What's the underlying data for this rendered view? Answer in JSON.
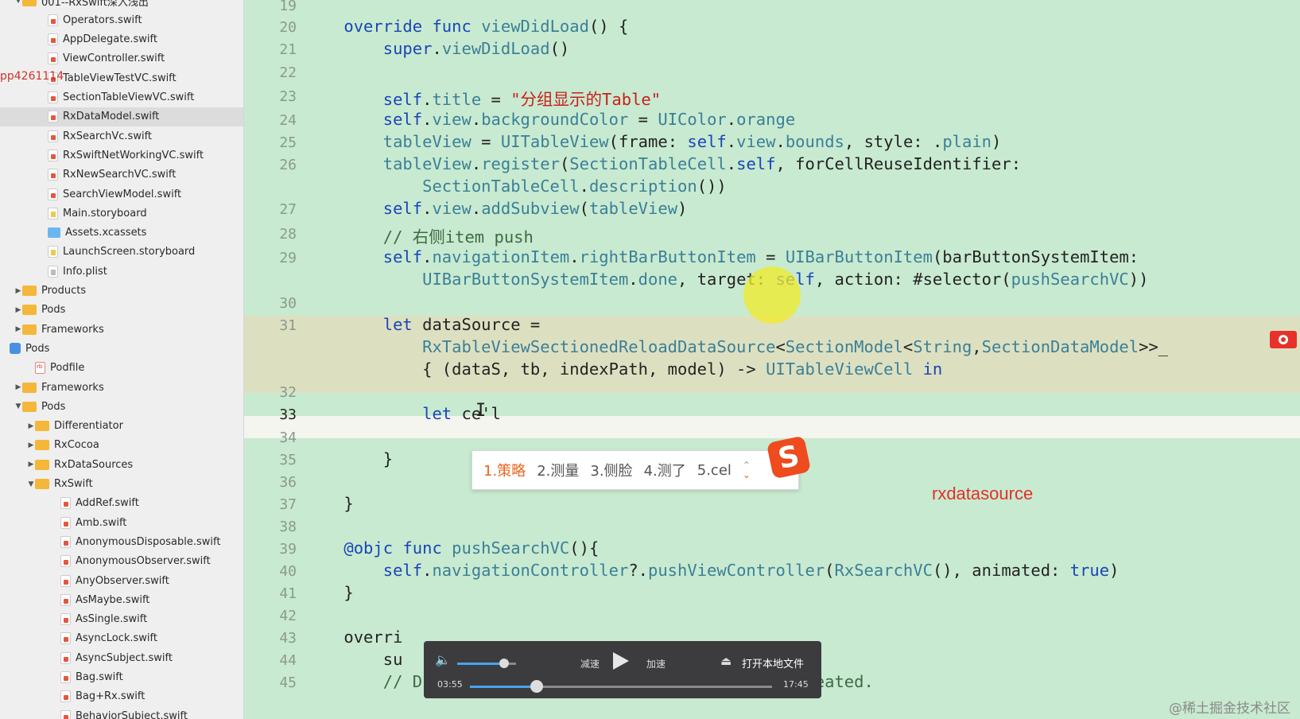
{
  "sidebar": {
    "items": [
      {
        "label": "001--RxSwift深入浅出",
        "icon": "folder-icon",
        "indent": 1,
        "expanded": true
      },
      {
        "label": "Operators.swift",
        "icon": "swift-file-icon",
        "indent": 3
      },
      {
        "label": "AppDelegate.swift",
        "icon": "swift-file-icon",
        "indent": 3
      },
      {
        "label": "ViewController.swift",
        "icon": "swift-file-icon",
        "indent": 3
      },
      {
        "label": "TableViewTestVC.swift",
        "icon": "swift-file-icon",
        "indent": 3
      },
      {
        "label": "SectionTableViewVC.swift",
        "icon": "swift-file-icon",
        "indent": 3
      },
      {
        "label": "RxDataModel.swift",
        "icon": "swift-file-icon",
        "indent": 3,
        "selected": true
      },
      {
        "label": "RxSearchVc.swift",
        "icon": "swift-file-icon",
        "indent": 3
      },
      {
        "label": "RxSwiftNetWorkingVC.swift",
        "icon": "swift-file-icon",
        "indent": 3
      },
      {
        "label": "RxNewSearchVC.swift",
        "icon": "swift-file-icon",
        "indent": 3
      },
      {
        "label": "SearchViewModel.swift",
        "icon": "swift-file-icon",
        "indent": 3
      },
      {
        "label": "Main.storyboard",
        "icon": "storyboard-file-icon",
        "indent": 3
      },
      {
        "label": "Assets.xcassets",
        "icon": "assets-folder-icon",
        "indent": 3
      },
      {
        "label": "LaunchScreen.storyboard",
        "icon": "storyboard-file-icon",
        "indent": 3
      },
      {
        "label": "Info.plist",
        "icon": "plist-file-icon",
        "indent": 3
      },
      {
        "label": "Products",
        "icon": "folder-icon",
        "indent": 1,
        "collapsed": true
      },
      {
        "label": "Pods",
        "icon": "folder-icon",
        "indent": 1,
        "collapsed": true
      },
      {
        "label": "Frameworks",
        "icon": "folder-icon",
        "indent": 1,
        "collapsed": true
      },
      {
        "label": "Pods",
        "icon": "pods-project-icon",
        "indent": 0
      },
      {
        "label": "Podfile",
        "icon": "podfile-icon",
        "indent": 2
      },
      {
        "label": "Frameworks",
        "icon": "folder-icon",
        "indent": 1,
        "collapsed": true
      },
      {
        "label": "Pods",
        "icon": "folder-icon",
        "indent": 1,
        "expanded": true
      },
      {
        "label": "Differentiator",
        "icon": "folder-icon",
        "indent": 2,
        "collapsed": true
      },
      {
        "label": "RxCocoa",
        "icon": "folder-icon",
        "indent": 2,
        "collapsed": true
      },
      {
        "label": "RxDataSources",
        "icon": "folder-icon",
        "indent": 2,
        "collapsed": true
      },
      {
        "label": "RxSwift",
        "icon": "folder-icon",
        "indent": 2,
        "expanded": true
      },
      {
        "label": "AddRef.swift",
        "icon": "swift-file-icon",
        "indent": 4
      },
      {
        "label": "Amb.swift",
        "icon": "swift-file-icon",
        "indent": 4
      },
      {
        "label": "AnonymousDisposable.swift",
        "icon": "swift-file-icon",
        "indent": 4
      },
      {
        "label": "AnonymousObserver.swift",
        "icon": "swift-file-icon",
        "indent": 4
      },
      {
        "label": "AnyObserver.swift",
        "icon": "swift-file-icon",
        "indent": 4
      },
      {
        "label": "AsMaybe.swift",
        "icon": "swift-file-icon",
        "indent": 4
      },
      {
        "label": "AsSingle.swift",
        "icon": "swift-file-icon",
        "indent": 4
      },
      {
        "label": "AsyncLock.swift",
        "icon": "swift-file-icon",
        "indent": 4
      },
      {
        "label": "AsyncSubject.swift",
        "icon": "swift-file-icon",
        "indent": 4
      },
      {
        "label": "Bag.swift",
        "icon": "swift-file-icon",
        "indent": 4
      },
      {
        "label": "Bag+Rx.swift",
        "icon": "swift-file-icon",
        "indent": 4
      },
      {
        "label": "BehaviorSubject.swift",
        "icon": "swift-file-icon",
        "indent": 4
      }
    ],
    "overlay_label": "pp4261114"
  },
  "editor": {
    "lines": [
      {
        "num": "19",
        "code": ""
      },
      {
        "num": "20",
        "code": "    override func viewDidLoad() {"
      },
      {
        "num": "21",
        "code": "        super.viewDidLoad()"
      },
      {
        "num": "22",
        "code": ""
      },
      {
        "num": "23",
        "code": "        self.title = \"分组显示的Table\""
      },
      {
        "num": "24",
        "code": "        self.view.backgroundColor = UIColor.orange"
      },
      {
        "num": "25",
        "code": "        tableView = UITableView(frame: self.view.bounds, style: .plain)"
      },
      {
        "num": "26",
        "code": "        tableView.register(SectionTableCell.self, forCellReuseIdentifier:"
      },
      {
        "num": "",
        "code": "            SectionTableCell.description())"
      },
      {
        "num": "27",
        "code": "        self.view.addSubview(tableView)"
      },
      {
        "num": "28",
        "code": "        // 右侧item push"
      },
      {
        "num": "29",
        "code": "        self.navigationItem.rightBarButtonItem = UIBarButtonItem(barButtonSystemItem:"
      },
      {
        "num": "",
        "code": "            UIBarButtonSystemItem.done, target: self, action: #selector(pushSearchVC))"
      },
      {
        "num": "30",
        "code": ""
      },
      {
        "num": "31",
        "code": "        let dataSource ="
      },
      {
        "num": "",
        "code": "            RxTableViewSectionedReloadDataSource<SectionModel<String,SectionDataModel>>_"
      },
      {
        "num": "",
        "code": "            { (dataS, tb, indexPath, model) -> UITableViewCell in"
      },
      {
        "num": "32",
        "code": ""
      },
      {
        "num": "33",
        "code": "            let ce'l"
      },
      {
        "num": "34",
        "code": ""
      },
      {
        "num": "35",
        "code": "        }"
      },
      {
        "num": "36",
        "code": ""
      },
      {
        "num": "37",
        "code": "    }"
      },
      {
        "num": "38",
        "code": ""
      },
      {
        "num": "39",
        "code": "    @objc func pushSearchVC(){"
      },
      {
        "num": "40",
        "code": "        self.navigationController?.pushViewController(RxSearchVC(), animated: true)"
      },
      {
        "num": "41",
        "code": "    }"
      },
      {
        "num": "42",
        "code": ""
      },
      {
        "num": "43",
        "code": "    overri"
      },
      {
        "num": "44",
        "code": "        su"
      },
      {
        "num": "45",
        "code": "        // Dispose of any resources that can be recreated."
      }
    ],
    "current_line": "33",
    "error_line": "31"
  },
  "ime": {
    "candidates": [
      "1.策略",
      "2.测量",
      "3.侧脸",
      "4.测了",
      "5.cel"
    ],
    "logo_letter": "S"
  },
  "annotation": "rxdatasource",
  "player": {
    "slow_label": "减速",
    "fast_label": "加速",
    "open_label": "打开本地文件",
    "current_time": "03:55",
    "total_time": "17:45",
    "volume_fraction": 0.8,
    "progress_fraction": 0.22
  },
  "watermark": "@稀土掘金技术社区",
  "colors": {
    "editor_bg": "#c8ead0",
    "keyword": "#1a45b8",
    "type": "#3b7f98",
    "string": "#c8201c",
    "accent": "#4aa3f0",
    "error": "#e8312a"
  }
}
